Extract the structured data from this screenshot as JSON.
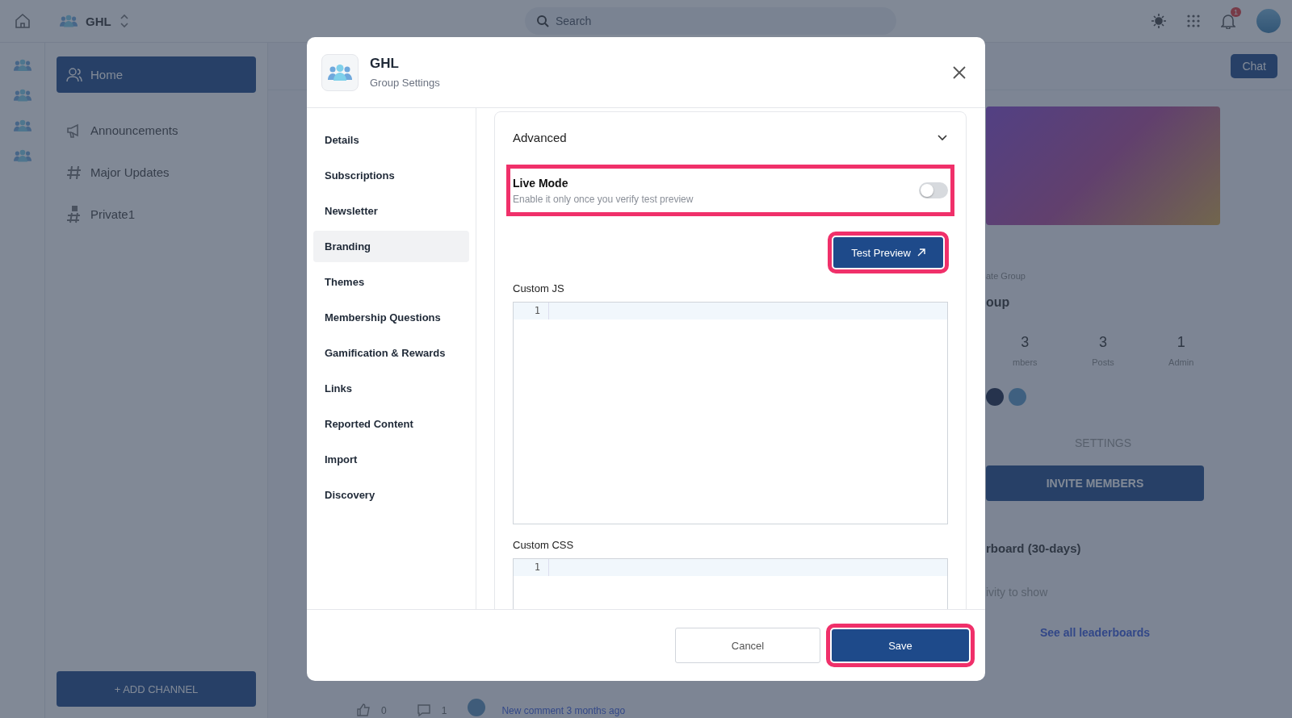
{
  "topbar": {
    "workspace": "GHL",
    "search_placeholder": "Search",
    "notification_count": "1"
  },
  "sidebar": {
    "items": [
      {
        "label": "Home",
        "kind": "person",
        "selected": true
      },
      {
        "label": "Announcements",
        "kind": "megaphone",
        "selected": false
      },
      {
        "label": "Major Updates",
        "kind": "hash",
        "selected": false
      },
      {
        "label": "Private1",
        "kind": "private",
        "selected": false
      }
    ],
    "add_button": "+ ADD CHANNEL"
  },
  "right_panel": {
    "chat": "Chat",
    "privacy": "ate Group",
    "group_name": "oup",
    "stats": [
      {
        "value": "3",
        "label": "mbers"
      },
      {
        "value": "3",
        "label": "Posts"
      },
      {
        "value": "1",
        "label": "Admin"
      }
    ],
    "settings": "SETTINGS",
    "invite": "INVITE MEMBERS",
    "leaderboard_title": "rboard (30-days)",
    "empty": "ivity to show",
    "see_all": "See all leaderboards"
  },
  "feed": {
    "likes": "0",
    "comments": "1",
    "link": "New comment 3 months ago"
  },
  "modal": {
    "title": "GHL",
    "subtitle": "Group Settings",
    "nav": [
      {
        "label": "Details",
        "selected": false
      },
      {
        "label": "Subscriptions",
        "selected": false
      },
      {
        "label": "Newsletter",
        "selected": false
      },
      {
        "label": "Branding",
        "selected": true
      },
      {
        "label": "Themes",
        "selected": false
      },
      {
        "label": "Membership Questions",
        "selected": false
      },
      {
        "label": "Gamification & Rewards",
        "selected": false
      },
      {
        "label": "Links",
        "selected": false
      },
      {
        "label": "Reported Content",
        "selected": false
      },
      {
        "label": "Import",
        "selected": false
      },
      {
        "label": "Discovery",
        "selected": false
      }
    ],
    "section": {
      "title": "Advanced",
      "expanded": true
    },
    "live_mode": {
      "label": "Live Mode",
      "hint": "Enable it only once you verify test preview",
      "on": false,
      "highlighted": true
    },
    "test_preview": {
      "label": "Test Preview",
      "highlighted": true
    },
    "custom_js": {
      "label": "Custom JS",
      "line_number": "1"
    },
    "custom_css": {
      "label": "Custom CSS",
      "line_number": "1"
    },
    "cancel": "Cancel",
    "save": {
      "label": "Save",
      "highlighted": true
    }
  }
}
